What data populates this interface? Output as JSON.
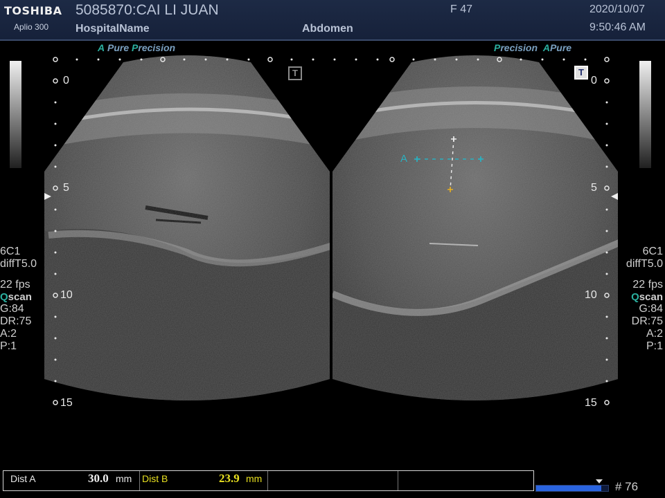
{
  "header": {
    "brand": "TOSHIBA",
    "model": "Aplio 300",
    "patient": "5085870:CAI LI JUAN",
    "hospital": "HospitalName",
    "exam": "Abdomen",
    "sex_age": "F 47",
    "date": "2020/10/07",
    "time": "9:50:46 AM"
  },
  "left_panel": {
    "mode_a": "A",
    "mode_pure": "Pure",
    "mode_p": "P",
    "mode_precision": "recision",
    "depth_labels": [
      "0",
      "5",
      "10",
      "15"
    ]
  },
  "right_panel": {
    "mode_p": "P",
    "mode_precision": "recision",
    "mode_a": "A",
    "mode_pure": "Pure",
    "depth_labels": [
      "0",
      "5",
      "10",
      "15"
    ],
    "caliper_label": "A"
  },
  "params_left": {
    "probe": "6C1",
    "preset": "diffT5.0",
    "fps": "22 fps",
    "q": "Q",
    "scan": "scan",
    "gain": "G:84",
    "dr": "DR:75",
    "a": "A:2",
    "p": "P:1"
  },
  "params_right": {
    "probe": "6C1",
    "preset": "diffT5.0",
    "fps": "22 fps",
    "q": "Q",
    "scan": "scan",
    "gain": "G:84",
    "dr": "DR:75",
    "a": "A:2",
    "p": "P:1"
  },
  "measurements": [
    {
      "label": "Dist A",
      "value": "30.0",
      "unit": "mm"
    },
    {
      "label": "Dist B",
      "value": "23.9",
      "unit": "mm"
    }
  ],
  "footer": {
    "frame_count": "# 76",
    "cine_progress": 0.9
  },
  "colors": {
    "header_bg": "#1d2a45",
    "accent_teal": "#2bb0a0",
    "caliper_b": "#e8e020",
    "progress": "#2a64e0"
  }
}
